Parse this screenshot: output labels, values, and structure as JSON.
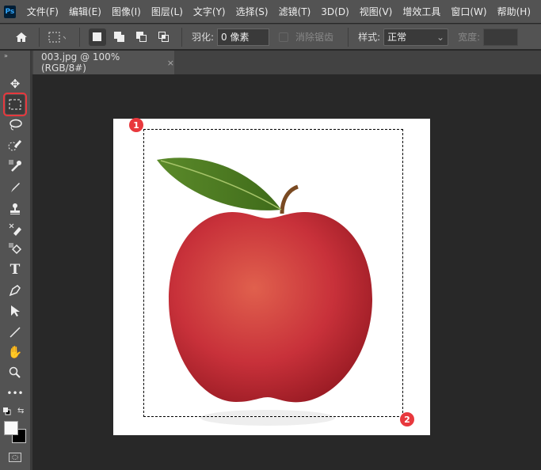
{
  "app": {
    "logo": "Ps"
  },
  "menu": [
    "文件(F)",
    "编辑(E)",
    "图像(I)",
    "图层(L)",
    "文字(Y)",
    "选择(S)",
    "滤镜(T)",
    "3D(D)",
    "视图(V)",
    "增效工具",
    "窗口(W)",
    "帮助(H)"
  ],
  "options": {
    "feather_label": "羽化:",
    "feather_value": "0 像素",
    "antialias_label": "消除锯齿",
    "style_label": "样式:",
    "style_value": "正常",
    "width_label": "宽度:"
  },
  "document": {
    "tab_title": "003.jpg @ 100%(RGB/8#)",
    "close": "×"
  },
  "annotations": {
    "badge1": "1",
    "badge2": "2",
    "highlight_color": "#e8383d"
  },
  "tools": [
    "move",
    "rectangular-marquee",
    "lasso",
    "quick-selection",
    "eyedropper",
    "brush",
    "clone-stamp",
    "eraser",
    "paint-bucket",
    "type",
    "pen",
    "path-selection",
    "line",
    "hand",
    "zoom",
    "more",
    "swap-colors",
    "color-swatches",
    "quick-mask"
  ]
}
